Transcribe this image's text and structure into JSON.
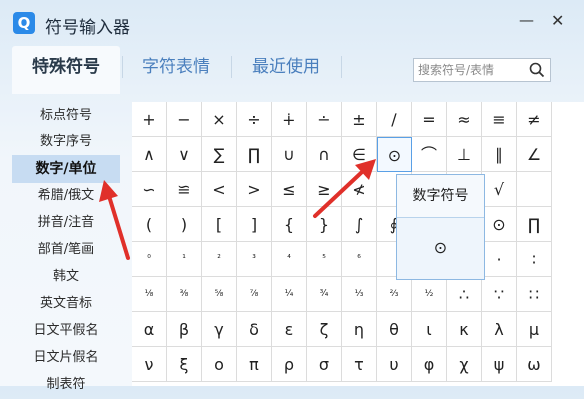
{
  "app": {
    "icon_text": "Q",
    "title": "符号输入器"
  },
  "window": {
    "minimize_glyph": "—",
    "close_glyph": "✕"
  },
  "tabs": [
    {
      "label": "特殊符号",
      "active": true
    },
    {
      "label": "字符表情",
      "active": false
    },
    {
      "label": "最近使用",
      "active": false
    }
  ],
  "search": {
    "placeholder": "搜索符号/表情"
  },
  "sidebar": {
    "items": [
      {
        "label": "标点符号"
      },
      {
        "label": "数字序号"
      },
      {
        "label": "数字/单位",
        "active": true
      },
      {
        "label": "希腊/俄文"
      },
      {
        "label": "拼音/注音"
      },
      {
        "label": "部首/笔画"
      },
      {
        "label": "韩文"
      },
      {
        "label": "英文音标"
      },
      {
        "label": "日文平假名"
      },
      {
        "label": "日文片假名"
      },
      {
        "label": "制表符"
      }
    ]
  },
  "symbol_grid": {
    "rows": [
      [
        "+",
        "−",
        "×",
        "÷",
        "∔",
        "∸",
        "±",
        "∕",
        "=",
        "≈",
        "≡",
        "≠"
      ],
      [
        "∧",
        "∨",
        "∑",
        "∏",
        "∪",
        "∩",
        "∈",
        "⊙",
        "⌒",
        "⊥",
        "∥",
        "∠"
      ],
      [
        "∽",
        "≌",
        "<",
        ">",
        "≤",
        "≥",
        "≮",
        "",
        "",
        "",
        "√",
        ""
      ],
      [
        "(",
        ")",
        "[",
        "]",
        "{",
        "}",
        "∫",
        "∮",
        "",
        "",
        "⊙",
        "∏"
      ],
      [
        "⁰",
        "¹",
        "²",
        "³",
        "⁴",
        "⁵",
        "⁶",
        "",
        "",
        "",
        "·",
        "∶"
      ],
      [
        "⅛",
        "⅜",
        "⅝",
        "⅞",
        "¼",
        "¾",
        "⅓",
        "⅔",
        "½",
        "∴",
        "∵",
        "∷"
      ],
      [
        "α",
        "β",
        "γ",
        "δ",
        "ε",
        "ζ",
        "η",
        "θ",
        "ι",
        "κ",
        "λ",
        "μ"
      ],
      [
        "ν",
        "ξ",
        "ο",
        "π",
        "ρ",
        "σ",
        "τ",
        "υ",
        "φ",
        "χ",
        "ψ",
        "ω"
      ]
    ],
    "selected": {
      "row": 1,
      "col": 7
    }
  },
  "tooltip": {
    "title": "数字符号",
    "symbol": "⊙"
  },
  "annotation": {
    "color": "#e0302a"
  }
}
